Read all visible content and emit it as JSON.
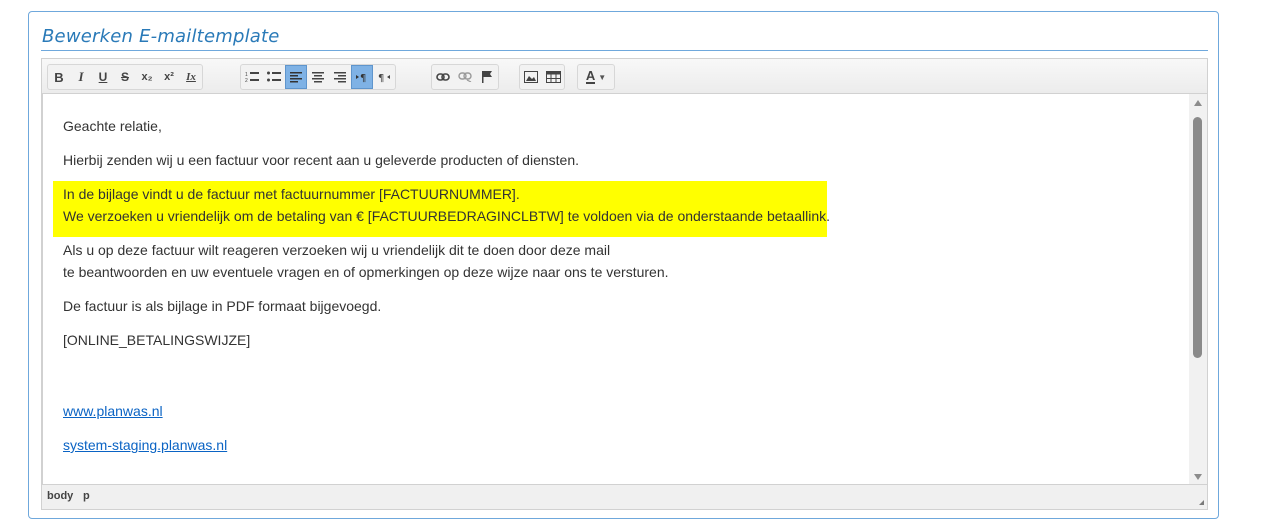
{
  "panel": {
    "title": "Bewerken E-mailtemplate"
  },
  "toolbar": {
    "groups": [
      [
        "bold-icon",
        "italic-icon",
        "underline-icon",
        "strikethrough-icon",
        "subscript-icon",
        "superscript-icon",
        "remove-format-icon"
      ],
      [
        "numbered-list-icon",
        "bulleted-list-icon",
        "align-left-icon",
        "align-center-icon",
        "align-right-icon",
        "ltr-icon",
        "rtl-icon"
      ],
      [
        "link-icon",
        "unlink-icon",
        "anchor-icon"
      ],
      [
        "image-icon",
        "table-icon"
      ],
      [
        "text-color-icon"
      ]
    ],
    "glyphs": {
      "bold": "B",
      "italic": "I",
      "underline": "U",
      "strike": "S",
      "subscript": "x₂",
      "superscript": "x²",
      "removeformat": "Ix",
      "textcolor": "A"
    },
    "active": [
      "align-left-icon",
      "ltr-icon"
    ]
  },
  "content": {
    "greeting": "Geachte relatie,",
    "intro": "Hierbij zenden wij u een factuur voor recent aan u geleverde producten of diensten.",
    "highlight_line1": "In de bijlage vindt u de factuur met factuurnummer [FACTUURNUMMER].",
    "highlight_line2": "We verzoeken u vriendelijk om de betaling van € [FACTUURBEDRAGINCLBTW] te voldoen via de onderstaande betaallink.",
    "reply_line1": "Als u op deze factuur wilt reageren verzoeken wij u vriendelijk dit te doen door deze mail",
    "reply_line2": "te beantwoorden en uw eventuele vragen en of opmerkingen op deze wijze naar ons te versturen.",
    "attachment": "De factuur is als bijlage in PDF formaat bijgevoegd.",
    "payment_placeholder": "[ONLINE_BETALINGSWIJZE]",
    "link1": "www.planwas.nl",
    "link2": "system-staging.planwas.nl",
    "highlight_color": "#ffff00"
  },
  "statusbar": {
    "path": [
      "body",
      "p"
    ]
  }
}
